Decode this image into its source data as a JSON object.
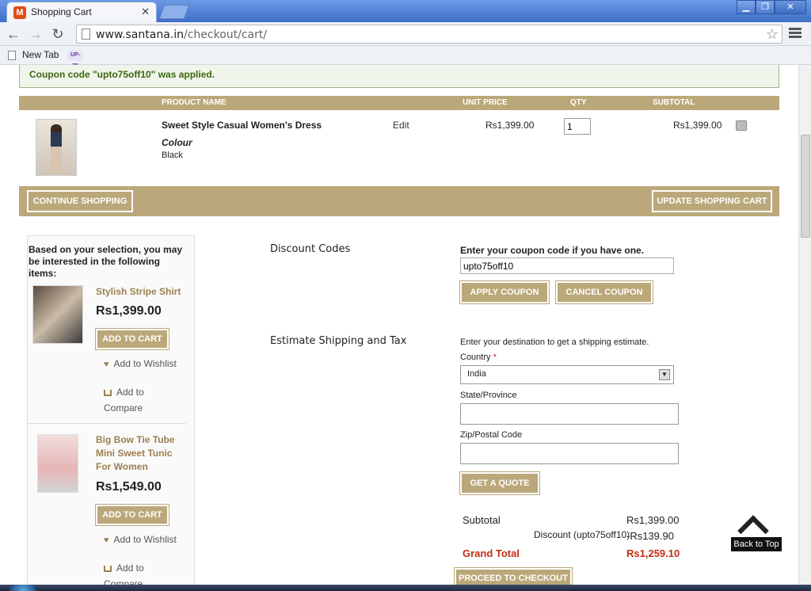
{
  "browser": {
    "tab_title": "Shopping Cart",
    "tab_close": "✕",
    "url_domain": "www.santana.in",
    "url_path": "/checkout/cart/",
    "bookmarks": [
      {
        "label": "New Tab"
      },
      {
        "label": "UP-75"
      }
    ],
    "window_buttons": {
      "minimize": "▁",
      "maximize": "❐",
      "close": "✕"
    },
    "nav": {
      "back": "←",
      "forward": "→",
      "reload": "↻",
      "star": "☆"
    }
  },
  "cart": {
    "success_message": "Coupon code \"upto75off10\" was applied.",
    "headers": {
      "product_name": "PRODUCT NAME",
      "unit_price": "UNIT PRICE",
      "qty": "QTY",
      "subtotal": "SUBTOTAL"
    },
    "item": {
      "name": "Sweet Style Casual Women's Dress",
      "option_label": "Colour",
      "option_value": "Black",
      "edit_label": "Edit",
      "unit_price": "Rs1,399.00",
      "qty": "1",
      "subtotal": "Rs1,399.00"
    },
    "continue_label": "CONTINUE SHOPPING",
    "update_label": "UPDATE SHOPPING CART"
  },
  "crosssell": {
    "title": "Based on your selection, you may be interested in the following items:",
    "items": [
      {
        "name": "Stylish Stripe Shirt",
        "price": "Rs1,399.00",
        "add_to_cart": "ADD TO CART",
        "wishlist": "Add to Wishlist",
        "compare": "Add to Compare"
      },
      {
        "name": "Big Bow Tie Tube Mini Sweet Tunic For Women",
        "price": "Rs1,549.00",
        "add_to_cart": "ADD TO CART",
        "wishlist": "Add to Wishlist",
        "compare": "Add to Compare"
      }
    ]
  },
  "discount": {
    "title": "Discount Codes",
    "label": "Enter your coupon code if you have one.",
    "value": "upto75off10",
    "apply_label": "APPLY COUPON",
    "cancel_label": "CANCEL COUPON"
  },
  "shipping": {
    "title": "Estimate Shipping and Tax",
    "description": "Enter your destination to get a shipping estimate.",
    "country_label": "Country",
    "required_mark": "*",
    "country_value": "India",
    "state_label": "State/Province",
    "zip_label": "Zip/Postal Code",
    "quote_label": "GET A QUOTE"
  },
  "totals": {
    "subtotal_label": "Subtotal",
    "subtotal_value": "Rs1,399.00",
    "discount_label": "Discount (upto75off10)",
    "discount_value": "-Rs139.90",
    "grand_label": "Grand Total",
    "grand_value": "Rs1,259.10",
    "checkout_label": "PROCEED TO CHECKOUT"
  },
  "back_to_top": "Back to Top",
  "colors": {
    "brand_tan": "#bba87a",
    "link_gold": "#9c7f4e",
    "grand_total_red": "#c22e12",
    "success_green": "#3d6611"
  }
}
